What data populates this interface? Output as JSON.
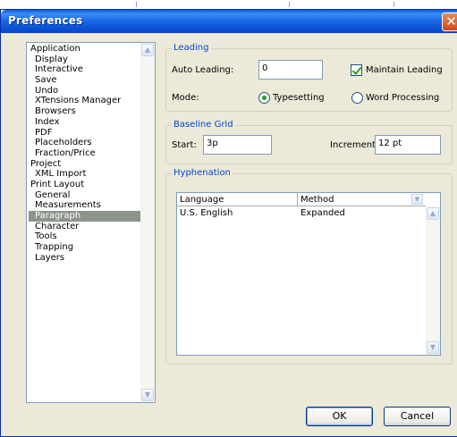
{
  "window": {
    "title": "Preferences"
  },
  "tree": {
    "items": [
      {
        "label": "Application",
        "level": 0
      },
      {
        "label": "Display",
        "level": 1
      },
      {
        "label": "Interactive",
        "level": 1
      },
      {
        "label": "Save",
        "level": 1
      },
      {
        "label": "Undo",
        "level": 1
      },
      {
        "label": "XTensions Manager",
        "level": 1
      },
      {
        "label": "Browsers",
        "level": 1
      },
      {
        "label": "Index",
        "level": 1
      },
      {
        "label": "PDF",
        "level": 1
      },
      {
        "label": "Placeholders",
        "level": 1
      },
      {
        "label": "Fraction/Price",
        "level": 1
      },
      {
        "label": "Project",
        "level": 0
      },
      {
        "label": "XML Import",
        "level": 1
      },
      {
        "label": "Print Layout",
        "level": 0
      },
      {
        "label": "General",
        "level": 1
      },
      {
        "label": "Measurements",
        "level": 1
      },
      {
        "label": "Paragraph",
        "level": 1,
        "selected": true
      },
      {
        "label": "Character",
        "level": 1
      },
      {
        "label": "Tools",
        "level": 1
      },
      {
        "label": "Trapping",
        "level": 1
      },
      {
        "label": "Layers",
        "level": 1
      }
    ]
  },
  "leading": {
    "legend": "Leading",
    "auto_label": "Auto Leading:",
    "auto_value": "0",
    "maintain_label": "Maintain Leading",
    "maintain_checked": true,
    "mode_label": "Mode:",
    "mode_options": [
      "Typesetting",
      "Word Processing"
    ],
    "mode_selected": "Typesetting"
  },
  "baseline": {
    "legend": "Baseline Grid",
    "start_label": "Start:",
    "start_value": "3p",
    "increment_label": "Increment:",
    "increment_value": "12 pt"
  },
  "hyphenation": {
    "legend": "Hyphenation",
    "columns": [
      "Language",
      "Method"
    ],
    "rows": [
      {
        "language": "U.S. English",
        "method": "Expanded"
      }
    ]
  },
  "buttons": {
    "ok": "OK",
    "cancel": "Cancel"
  },
  "colors": {
    "selection": "#8d9488",
    "legend_text": "#0046d5",
    "titlebar": "#0a5fd8"
  }
}
